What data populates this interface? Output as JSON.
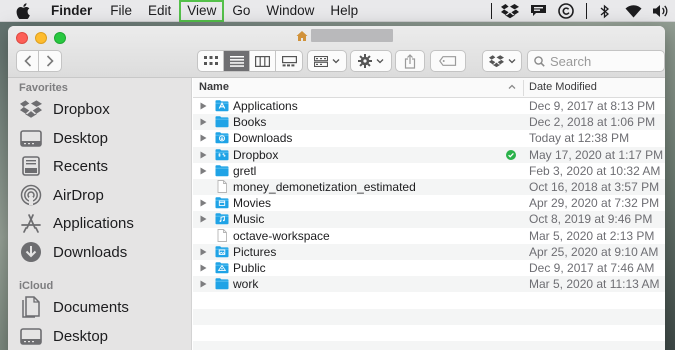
{
  "menubar": {
    "app_name": "Finder",
    "items": [
      "File",
      "Edit",
      "View",
      "Go",
      "Window",
      "Help"
    ],
    "highlighted_item": "View",
    "highlight_color": "#54c04a",
    "status_icons": [
      "dropbox-icon",
      "notification-icon",
      "sync-icon",
      "bluetooth-icon",
      "wifi-icon",
      "volume-icon"
    ]
  },
  "window": {
    "title_icon": "home-icon",
    "title": "",
    "search": {
      "placeholder": "Search",
      "value": ""
    },
    "view_mode": "list"
  },
  "sidebar": {
    "sections": [
      {
        "title": "Favorites",
        "items": [
          {
            "label": "Dropbox",
            "icon": "dropbox-icon"
          },
          {
            "label": "Desktop",
            "icon": "desktop-icon"
          },
          {
            "label": "Recents",
            "icon": "recents-icon"
          },
          {
            "label": "AirDrop",
            "icon": "airdrop-icon"
          },
          {
            "label": "Applications",
            "icon": "applications-icon"
          },
          {
            "label": "Downloads",
            "icon": "downloads-icon"
          }
        ]
      },
      {
        "title": "iCloud",
        "items": [
          {
            "label": "Documents",
            "icon": "documents-icon"
          },
          {
            "label": "Desktop",
            "icon": "desktop-icon"
          }
        ]
      }
    ]
  },
  "list": {
    "columns": {
      "name": "Name",
      "date": "Date Modified"
    },
    "rows": [
      {
        "name": "Applications",
        "date": "Dec 9, 2017 at 8:13 PM",
        "icon": "folder-applications-icon"
      },
      {
        "name": "Books",
        "date": "Dec 2, 2018 at 1:06 PM",
        "icon": "folder-icon"
      },
      {
        "name": "Downloads",
        "date": "Today at 12:38 PM",
        "icon": "folder-downloads-icon"
      },
      {
        "name": "Dropbox",
        "date": "May 17, 2020 at 1:17 PM",
        "icon": "folder-dropbox-icon",
        "synced": true
      },
      {
        "name": "gretl",
        "date": "Feb 3, 2020 at 10:32 AM",
        "icon": "folder-icon"
      },
      {
        "name": "money_demonetization_estimated",
        "date": "Oct 16, 2018 at 3:57 PM",
        "icon": "document-icon"
      },
      {
        "name": "Movies",
        "date": "Apr 29, 2020 at 7:32 PM",
        "icon": "folder-movies-icon"
      },
      {
        "name": "Music",
        "date": "Oct 8, 2019 at 9:46 PM",
        "icon": "folder-music-icon"
      },
      {
        "name": "octave-workspace",
        "date": "Mar 5, 2020 at 2:13 PM",
        "icon": "document-icon"
      },
      {
        "name": "Pictures",
        "date": "Apr 25, 2020 at 9:10 AM",
        "icon": "folder-pictures-icon"
      },
      {
        "name": "Public",
        "date": "Dec 9, 2017 at 7:46 AM",
        "icon": "folder-public-icon"
      },
      {
        "name": "work",
        "date": "Mar 5, 2020 at 11:13 AM",
        "icon": "folder-icon"
      }
    ]
  },
  "colors": {
    "folder_blue": "#1fa3e6",
    "sidebar_bg": "#e5e4e4",
    "synced_green": "#2ab24a"
  }
}
